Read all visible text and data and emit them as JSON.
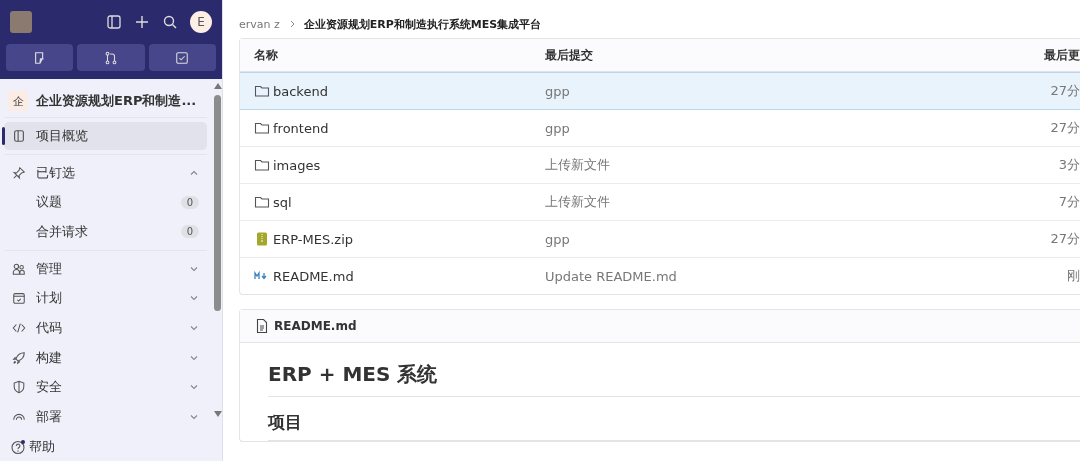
{
  "sidebar": {
    "avatar_initial": "E",
    "project": {
      "badge": "企",
      "name": "企业资源规划ERP和制造..."
    },
    "items": [
      {
        "kind": "link",
        "label": "项目概览",
        "selected": true
      },
      {
        "kind": "group",
        "label": "已钉选",
        "expanded": true,
        "children": [
          {
            "label": "议题",
            "count": "0"
          },
          {
            "label": "合并请求",
            "count": "0"
          }
        ]
      },
      {
        "kind": "group",
        "label": "管理",
        "expanded": false
      },
      {
        "kind": "group",
        "label": "计划",
        "expanded": false
      },
      {
        "kind": "group",
        "label": "代码",
        "expanded": false
      },
      {
        "kind": "group",
        "label": "构建",
        "expanded": false
      },
      {
        "kind": "group",
        "label": "安全",
        "expanded": false
      },
      {
        "kind": "group",
        "label": "部署",
        "expanded": false
      }
    ],
    "help": "帮助"
  },
  "breadcrumb": [
    "ervan z",
    "企业资源规划ERP和制造执行系统MES集成平台"
  ],
  "table": {
    "columns": [
      "名称",
      "最后提交",
      "最后更"
    ],
    "rows": [
      {
        "kind": "folder",
        "name": "backend",
        "commit": "gpp",
        "updated": "27分",
        "selected": true
      },
      {
        "kind": "folder",
        "name": "frontend",
        "commit": "gpp",
        "updated": "27分",
        "selected": false
      },
      {
        "kind": "folder",
        "name": "images",
        "commit": "上传新文件",
        "updated": "3分",
        "selected": false
      },
      {
        "kind": "folder",
        "name": "sql",
        "commit": "上传新文件",
        "updated": "7分",
        "selected": false
      },
      {
        "kind": "zip",
        "name": "ERP-MES.zip",
        "commit": "gpp",
        "updated": "27分",
        "selected": false
      },
      {
        "kind": "markdown",
        "name": "README.md",
        "commit": "Update README.md",
        "updated": "刚",
        "selected": false
      }
    ]
  },
  "readme": {
    "file": "README.md",
    "title": "ERP + MES 系统",
    "heading": "项目"
  }
}
